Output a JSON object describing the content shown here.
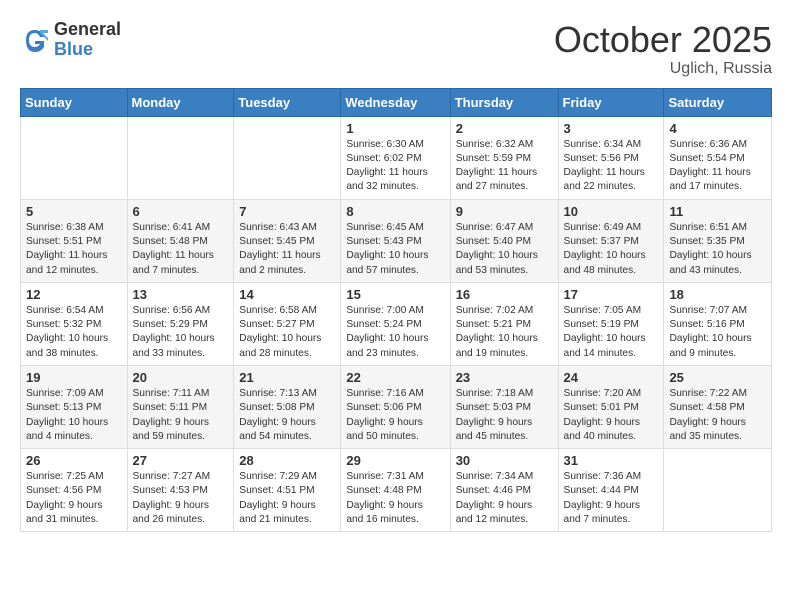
{
  "logo": {
    "general": "General",
    "blue": "Blue"
  },
  "title": "October 2025",
  "location": "Uglich, Russia",
  "days_header": [
    "Sunday",
    "Monday",
    "Tuesday",
    "Wednesday",
    "Thursday",
    "Friday",
    "Saturday"
  ],
  "weeks": [
    [
      {
        "day": "",
        "info": ""
      },
      {
        "day": "",
        "info": ""
      },
      {
        "day": "",
        "info": ""
      },
      {
        "day": "1",
        "info": "Sunrise: 6:30 AM\nSunset: 6:02 PM\nDaylight: 11 hours\nand 32 minutes."
      },
      {
        "day": "2",
        "info": "Sunrise: 6:32 AM\nSunset: 5:59 PM\nDaylight: 11 hours\nand 27 minutes."
      },
      {
        "day": "3",
        "info": "Sunrise: 6:34 AM\nSunset: 5:56 PM\nDaylight: 11 hours\nand 22 minutes."
      },
      {
        "day": "4",
        "info": "Sunrise: 6:36 AM\nSunset: 5:54 PM\nDaylight: 11 hours\nand 17 minutes."
      }
    ],
    [
      {
        "day": "5",
        "info": "Sunrise: 6:38 AM\nSunset: 5:51 PM\nDaylight: 11 hours\nand 12 minutes."
      },
      {
        "day": "6",
        "info": "Sunrise: 6:41 AM\nSunset: 5:48 PM\nDaylight: 11 hours\nand 7 minutes."
      },
      {
        "day": "7",
        "info": "Sunrise: 6:43 AM\nSunset: 5:45 PM\nDaylight: 11 hours\nand 2 minutes."
      },
      {
        "day": "8",
        "info": "Sunrise: 6:45 AM\nSunset: 5:43 PM\nDaylight: 10 hours\nand 57 minutes."
      },
      {
        "day": "9",
        "info": "Sunrise: 6:47 AM\nSunset: 5:40 PM\nDaylight: 10 hours\nand 53 minutes."
      },
      {
        "day": "10",
        "info": "Sunrise: 6:49 AM\nSunset: 5:37 PM\nDaylight: 10 hours\nand 48 minutes."
      },
      {
        "day": "11",
        "info": "Sunrise: 6:51 AM\nSunset: 5:35 PM\nDaylight: 10 hours\nand 43 minutes."
      }
    ],
    [
      {
        "day": "12",
        "info": "Sunrise: 6:54 AM\nSunset: 5:32 PM\nDaylight: 10 hours\nand 38 minutes."
      },
      {
        "day": "13",
        "info": "Sunrise: 6:56 AM\nSunset: 5:29 PM\nDaylight: 10 hours\nand 33 minutes."
      },
      {
        "day": "14",
        "info": "Sunrise: 6:58 AM\nSunset: 5:27 PM\nDaylight: 10 hours\nand 28 minutes."
      },
      {
        "day": "15",
        "info": "Sunrise: 7:00 AM\nSunset: 5:24 PM\nDaylight: 10 hours\nand 23 minutes."
      },
      {
        "day": "16",
        "info": "Sunrise: 7:02 AM\nSunset: 5:21 PM\nDaylight: 10 hours\nand 19 minutes."
      },
      {
        "day": "17",
        "info": "Sunrise: 7:05 AM\nSunset: 5:19 PM\nDaylight: 10 hours\nand 14 minutes."
      },
      {
        "day": "18",
        "info": "Sunrise: 7:07 AM\nSunset: 5:16 PM\nDaylight: 10 hours\nand 9 minutes."
      }
    ],
    [
      {
        "day": "19",
        "info": "Sunrise: 7:09 AM\nSunset: 5:13 PM\nDaylight: 10 hours\nand 4 minutes."
      },
      {
        "day": "20",
        "info": "Sunrise: 7:11 AM\nSunset: 5:11 PM\nDaylight: 9 hours\nand 59 minutes."
      },
      {
        "day": "21",
        "info": "Sunrise: 7:13 AM\nSunset: 5:08 PM\nDaylight: 9 hours\nand 54 minutes."
      },
      {
        "day": "22",
        "info": "Sunrise: 7:16 AM\nSunset: 5:06 PM\nDaylight: 9 hours\nand 50 minutes."
      },
      {
        "day": "23",
        "info": "Sunrise: 7:18 AM\nSunset: 5:03 PM\nDaylight: 9 hours\nand 45 minutes."
      },
      {
        "day": "24",
        "info": "Sunrise: 7:20 AM\nSunset: 5:01 PM\nDaylight: 9 hours\nand 40 minutes."
      },
      {
        "day": "25",
        "info": "Sunrise: 7:22 AM\nSunset: 4:58 PM\nDaylight: 9 hours\nand 35 minutes."
      }
    ],
    [
      {
        "day": "26",
        "info": "Sunrise: 7:25 AM\nSunset: 4:56 PM\nDaylight: 9 hours\nand 31 minutes."
      },
      {
        "day": "27",
        "info": "Sunrise: 7:27 AM\nSunset: 4:53 PM\nDaylight: 9 hours\nand 26 minutes."
      },
      {
        "day": "28",
        "info": "Sunrise: 7:29 AM\nSunset: 4:51 PM\nDaylight: 9 hours\nand 21 minutes."
      },
      {
        "day": "29",
        "info": "Sunrise: 7:31 AM\nSunset: 4:48 PM\nDaylight: 9 hours\nand 16 minutes."
      },
      {
        "day": "30",
        "info": "Sunrise: 7:34 AM\nSunset: 4:46 PM\nDaylight: 9 hours\nand 12 minutes."
      },
      {
        "day": "31",
        "info": "Sunrise: 7:36 AM\nSunset: 4:44 PM\nDaylight: 9 hours\nand 7 minutes."
      },
      {
        "day": "",
        "info": ""
      }
    ]
  ]
}
